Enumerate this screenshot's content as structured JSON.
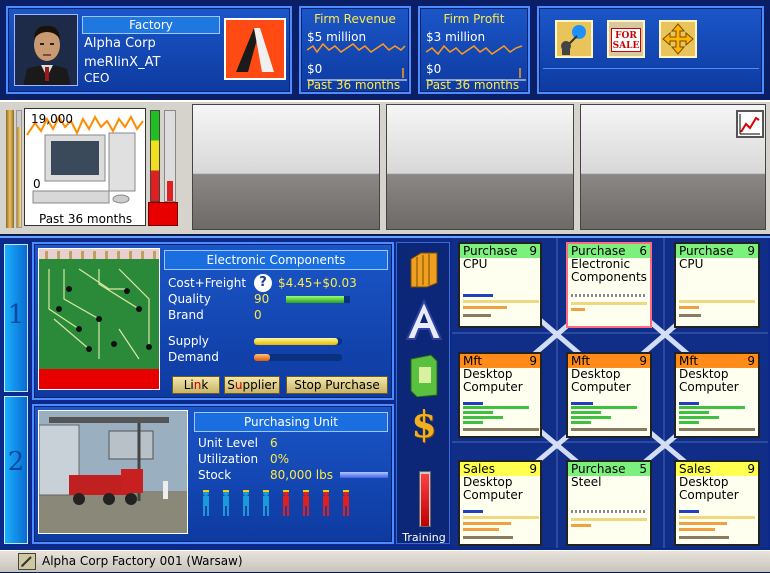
{
  "header": {
    "ceo": {
      "facility_type": "Factory",
      "company": "Alpha Corp",
      "username": "meRlinX_AT",
      "role": "CEO"
    },
    "revenue": {
      "title": "Firm Revenue",
      "top_value": "$5 million",
      "bottom_value": "$0",
      "period": "Past 36 months"
    },
    "profit": {
      "title": "Firm Profit",
      "top_value": "$3 million",
      "bottom_value": "$0",
      "period": "Past 36 months"
    },
    "tools": [
      "network-icon",
      "for-sale-icon",
      "move-icon"
    ],
    "for_sale_label": "FOR SALE"
  },
  "production_strip": {
    "chart_top": "19,000",
    "chart_bottom": "0",
    "period": "Past 36 months"
  },
  "unit1": {
    "tab": "1",
    "product": "Electronic Components",
    "cost_label": "Cost+Freight",
    "cost_value": "$4.45+$0.03",
    "quality_label": "Quality",
    "quality_value": "90",
    "brand_label": "Brand",
    "brand_value": "0",
    "supply_label": "Supply",
    "demand_label": "Demand",
    "supply_level": 0.95,
    "demand_level": 0.18,
    "quality_level": 0.9,
    "buttons": {
      "link": "Link",
      "supplier": "Supplier",
      "stop": "Stop Purchase"
    }
  },
  "unit2": {
    "tab": "2",
    "title": "Purchasing Unit",
    "level_label": "Unit Level",
    "level_value": "6",
    "util_label": "Utilization",
    "util_value": "0%",
    "stock_label": "Stock",
    "stock_value": "80,000 lbs",
    "training_label": "Training"
  },
  "status_bar": {
    "text": "Alpha Corp Factory 001 (Warsaw)"
  },
  "grid": [
    {
      "type": "Purchase",
      "level": "9",
      "product": "CPU",
      "color": "#7cf07c"
    },
    {
      "type": "Purchase",
      "level": "6",
      "product": "Electronic Components",
      "color": "#7cf07c",
      "selected": true
    },
    {
      "type": "Purchase",
      "level": "9",
      "product": "CPU",
      "color": "#7cf07c"
    },
    {
      "type": "Mft",
      "level": "9",
      "product": "Desktop Computer",
      "color": "#ff8c1a"
    },
    {
      "type": "Mft",
      "level": "9",
      "product": "Desktop Computer",
      "color": "#ff8c1a"
    },
    {
      "type": "Mft",
      "level": "9",
      "product": "Desktop Computer",
      "color": "#ff8c1a"
    },
    {
      "type": "Sales",
      "level": "9",
      "product": "Desktop Computer",
      "color": "#ffff50"
    },
    {
      "type": "Purchase",
      "level": "5",
      "product": "Steel",
      "color": "#7cf07c"
    },
    {
      "type": "Sales",
      "level": "9",
      "product": "Desktop Computer",
      "color": "#ffff50"
    }
  ]
}
